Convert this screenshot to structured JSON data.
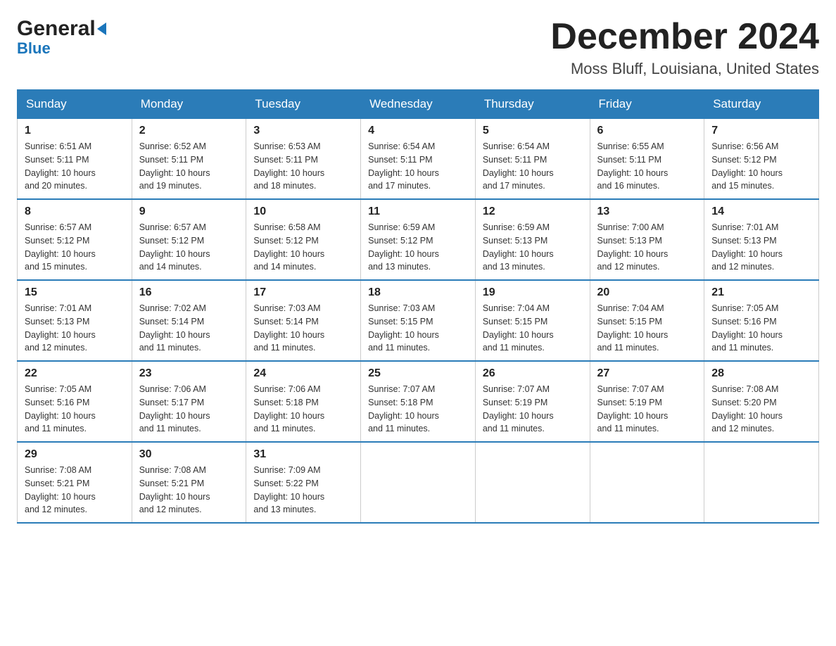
{
  "logo": {
    "general": "General",
    "blue": "Blue"
  },
  "header": {
    "month": "December 2024",
    "location": "Moss Bluff, Louisiana, United States"
  },
  "days_of_week": [
    "Sunday",
    "Monday",
    "Tuesday",
    "Wednesday",
    "Thursday",
    "Friday",
    "Saturday"
  ],
  "weeks": [
    [
      {
        "day": "1",
        "sunrise": "6:51 AM",
        "sunset": "5:11 PM",
        "daylight": "10 hours and 20 minutes."
      },
      {
        "day": "2",
        "sunrise": "6:52 AM",
        "sunset": "5:11 PM",
        "daylight": "10 hours and 19 minutes."
      },
      {
        "day": "3",
        "sunrise": "6:53 AM",
        "sunset": "5:11 PM",
        "daylight": "10 hours and 18 minutes."
      },
      {
        "day": "4",
        "sunrise": "6:54 AM",
        "sunset": "5:11 PM",
        "daylight": "10 hours and 17 minutes."
      },
      {
        "day": "5",
        "sunrise": "6:54 AM",
        "sunset": "5:11 PM",
        "daylight": "10 hours and 17 minutes."
      },
      {
        "day": "6",
        "sunrise": "6:55 AM",
        "sunset": "5:11 PM",
        "daylight": "10 hours and 16 minutes."
      },
      {
        "day": "7",
        "sunrise": "6:56 AM",
        "sunset": "5:12 PM",
        "daylight": "10 hours and 15 minutes."
      }
    ],
    [
      {
        "day": "8",
        "sunrise": "6:57 AM",
        "sunset": "5:12 PM",
        "daylight": "10 hours and 15 minutes."
      },
      {
        "day": "9",
        "sunrise": "6:57 AM",
        "sunset": "5:12 PM",
        "daylight": "10 hours and 14 minutes."
      },
      {
        "day": "10",
        "sunrise": "6:58 AM",
        "sunset": "5:12 PM",
        "daylight": "10 hours and 14 minutes."
      },
      {
        "day": "11",
        "sunrise": "6:59 AM",
        "sunset": "5:12 PM",
        "daylight": "10 hours and 13 minutes."
      },
      {
        "day": "12",
        "sunrise": "6:59 AM",
        "sunset": "5:13 PM",
        "daylight": "10 hours and 13 minutes."
      },
      {
        "day": "13",
        "sunrise": "7:00 AM",
        "sunset": "5:13 PM",
        "daylight": "10 hours and 12 minutes."
      },
      {
        "day": "14",
        "sunrise": "7:01 AM",
        "sunset": "5:13 PM",
        "daylight": "10 hours and 12 minutes."
      }
    ],
    [
      {
        "day": "15",
        "sunrise": "7:01 AM",
        "sunset": "5:13 PM",
        "daylight": "10 hours and 12 minutes."
      },
      {
        "day": "16",
        "sunrise": "7:02 AM",
        "sunset": "5:14 PM",
        "daylight": "10 hours and 11 minutes."
      },
      {
        "day": "17",
        "sunrise": "7:03 AM",
        "sunset": "5:14 PM",
        "daylight": "10 hours and 11 minutes."
      },
      {
        "day": "18",
        "sunrise": "7:03 AM",
        "sunset": "5:15 PM",
        "daylight": "10 hours and 11 minutes."
      },
      {
        "day": "19",
        "sunrise": "7:04 AM",
        "sunset": "5:15 PM",
        "daylight": "10 hours and 11 minutes."
      },
      {
        "day": "20",
        "sunrise": "7:04 AM",
        "sunset": "5:15 PM",
        "daylight": "10 hours and 11 minutes."
      },
      {
        "day": "21",
        "sunrise": "7:05 AM",
        "sunset": "5:16 PM",
        "daylight": "10 hours and 11 minutes."
      }
    ],
    [
      {
        "day": "22",
        "sunrise": "7:05 AM",
        "sunset": "5:16 PM",
        "daylight": "10 hours and 11 minutes."
      },
      {
        "day": "23",
        "sunrise": "7:06 AM",
        "sunset": "5:17 PM",
        "daylight": "10 hours and 11 minutes."
      },
      {
        "day": "24",
        "sunrise": "7:06 AM",
        "sunset": "5:18 PM",
        "daylight": "10 hours and 11 minutes."
      },
      {
        "day": "25",
        "sunrise": "7:07 AM",
        "sunset": "5:18 PM",
        "daylight": "10 hours and 11 minutes."
      },
      {
        "day": "26",
        "sunrise": "7:07 AM",
        "sunset": "5:19 PM",
        "daylight": "10 hours and 11 minutes."
      },
      {
        "day": "27",
        "sunrise": "7:07 AM",
        "sunset": "5:19 PM",
        "daylight": "10 hours and 11 minutes."
      },
      {
        "day": "28",
        "sunrise": "7:08 AM",
        "sunset": "5:20 PM",
        "daylight": "10 hours and 12 minutes."
      }
    ],
    [
      {
        "day": "29",
        "sunrise": "7:08 AM",
        "sunset": "5:21 PM",
        "daylight": "10 hours and 12 minutes."
      },
      {
        "day": "30",
        "sunrise": "7:08 AM",
        "sunset": "5:21 PM",
        "daylight": "10 hours and 12 minutes."
      },
      {
        "day": "31",
        "sunrise": "7:09 AM",
        "sunset": "5:22 PM",
        "daylight": "10 hours and 13 minutes."
      },
      null,
      null,
      null,
      null
    ]
  ],
  "labels": {
    "sunrise": "Sunrise:",
    "sunset": "Sunset:",
    "daylight": "Daylight:"
  }
}
